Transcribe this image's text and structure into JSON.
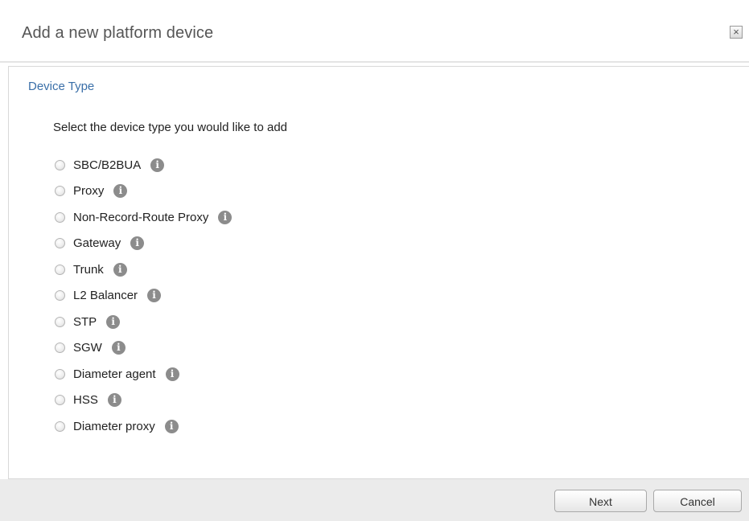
{
  "dialog": {
    "title": "Add a new platform device",
    "close_label": "×"
  },
  "section": {
    "title": "Device Type",
    "instruction": "Select the device type you would like to add"
  },
  "options": [
    {
      "label": "SBC/B2BUA",
      "selected": false,
      "info_icon": "info-icon"
    },
    {
      "label": "Proxy",
      "selected": false,
      "info_icon": "info-icon"
    },
    {
      "label": "Non-Record-Route Proxy",
      "selected": false,
      "info_icon": "info-icon"
    },
    {
      "label": "Gateway",
      "selected": false,
      "info_icon": "info-icon"
    },
    {
      "label": "Trunk",
      "selected": false,
      "info_icon": "info-icon"
    },
    {
      "label": "L2 Balancer",
      "selected": false,
      "info_icon": "info-icon"
    },
    {
      "label": "STP",
      "selected": false,
      "info_icon": "info-icon"
    },
    {
      "label": "SGW",
      "selected": false,
      "info_icon": "info-icon"
    },
    {
      "label": "Diameter agent",
      "selected": false,
      "info_icon": "info-icon"
    },
    {
      "label": "HSS",
      "selected": false,
      "info_icon": "info-icon"
    },
    {
      "label": "Diameter proxy",
      "selected": false,
      "info_icon": "info-icon"
    }
  ],
  "footer": {
    "next_label": "Next",
    "cancel_label": "Cancel"
  },
  "colors": {
    "section_title": "#3a6fa8",
    "footer_bg": "#ebebeb",
    "info_icon_bg": "#8c8c8c"
  }
}
